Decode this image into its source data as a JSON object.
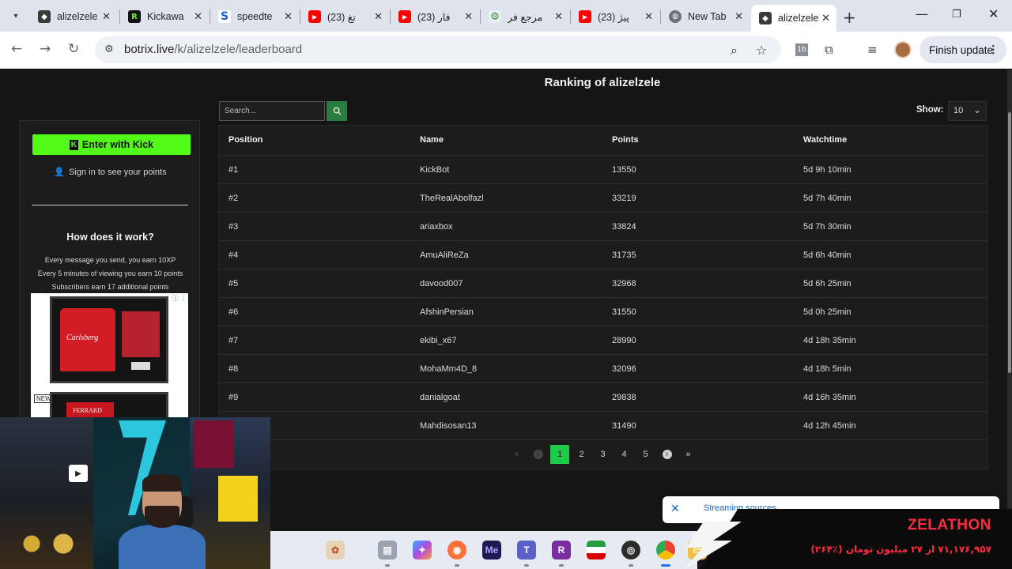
{
  "browser": {
    "tabs": [
      {
        "title": "alizelzele",
        "fav_color": "#3a3a3a",
        "fav_glyph": "◆"
      },
      {
        "title": "Kickawa",
        "fav_color": "#53fc18",
        "fav_glyph": "R"
      },
      {
        "title": "speedte",
        "fav_color": "#ffffff",
        "fav_glyph": "S"
      },
      {
        "title": "تغ (23)",
        "fav_color": "#ff0000",
        "fav_glyph": "▶"
      },
      {
        "title": "فار (23)",
        "fav_color": "#ff0000",
        "fav_glyph": "▶"
      },
      {
        "title": "مرجع فر",
        "fav_color": "#e9eef5",
        "fav_glyph": "⚙"
      },
      {
        "title": "پیژ (23)",
        "fav_color": "#ff0000",
        "fav_glyph": "▶"
      },
      {
        "title": "New Tab",
        "fav_color": "#dfe3eb",
        "fav_glyph": "🌐"
      },
      {
        "title": "alizelzele",
        "fav_color": "#3a3a3a",
        "fav_glyph": "◆",
        "active": true
      }
    ],
    "url_host": "botrix.live",
    "url_path": "/k/alizelzele/leaderboard",
    "finish_update_label": "Finish update"
  },
  "page": {
    "title": "Ranking of alizelzele"
  },
  "sidebar": {
    "kick_button_label": "Enter with Kick",
    "kick_glyph": "K",
    "signin_text": "Sign in to see your points",
    "how_title": "How does it work?",
    "how_lines": [
      "Every message you send, you earn 10XP",
      "Every 5 minutes of viewing you earn 10 points",
      "Subscribers earn 17 additional points"
    ],
    "ad": {
      "shirt_text": "Carlsberg",
      "new_badge": "NEW",
      "shirt2_text": "FERRARD"
    }
  },
  "controls": {
    "search_placeholder": "Search...",
    "show_label": "Show:",
    "show_value": "10"
  },
  "table": {
    "headers": [
      "Position",
      "Name",
      "Points",
      "Watchtime"
    ],
    "rows": [
      [
        "#1",
        "KickBot",
        "13550",
        "5d 9h 10min"
      ],
      [
        "#2",
        "TheRealAbolfazl",
        "33219",
        "5d 7h 40min"
      ],
      [
        "#3",
        "ariaxbox",
        "33824",
        "5d 7h 30min"
      ],
      [
        "#4",
        "AmuAliReZa",
        "31735",
        "5d 6h 40min"
      ],
      [
        "#5",
        "davood007",
        "32968",
        "5d 6h 25min"
      ],
      [
        "#6",
        "AfshinPersian",
        "31550",
        "5d 0h 25min"
      ],
      [
        "#7",
        "ekibi_x67",
        "28990",
        "4d 18h 35min"
      ],
      [
        "#8",
        "MohaMm4D_8",
        "32096",
        "4d 18h 5min"
      ],
      [
        "#9",
        "danialgoat",
        "29838",
        "4d 16h 35min"
      ],
      [
        "",
        "Mahdisosan13",
        "31490",
        "4d 12h 45min"
      ]
    ]
  },
  "pagination": {
    "first": "«",
    "prev": "‹",
    "next": "›",
    "last": "»",
    "pages": [
      "1",
      "2",
      "3",
      "4",
      "5"
    ],
    "active": "1"
  },
  "overlay": {
    "notification_text": "Streaming sources",
    "zelathon_title": "ZELATHON",
    "zelathon_subtitle": "۷۱,۱۷۶,۹۵۷ از ۲۷ میلیون تومان (٪۲۶۴)"
  },
  "taskbar": {
    "apps": [
      "widgets-icon",
      "files-icon",
      "copilot-icon",
      "firefox-icon",
      "media-encoder-icon",
      "teams-icon",
      "r-app-icon",
      "flag-icon",
      "obs-icon",
      "chrome-icon",
      "file-explorer-icon"
    ],
    "labels": {
      "media_encoder": "Me",
      "r_app": "R"
    }
  }
}
